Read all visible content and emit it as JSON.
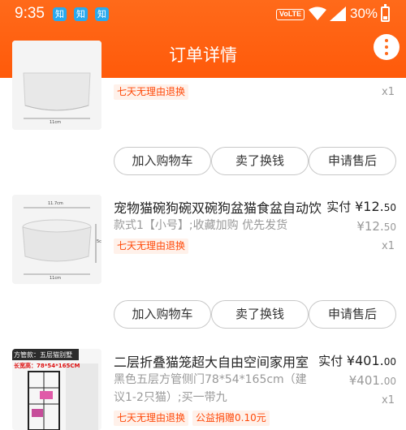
{
  "status_bar": {
    "time": "9:35",
    "notify_icons": [
      "知",
      "知",
      "知"
    ],
    "network": "VoLTE",
    "battery": "30%",
    "battery_level": 0.3
  },
  "header": {
    "title": "订单详情",
    "back_icon": "chevron-left-icon",
    "more_icon": "more-vertical-icon"
  },
  "items": [
    {
      "tag": "七天无理由退换",
      "qty": "x1",
      "thumb_label": "11cm",
      "actions": [
        "加入购物车",
        "卖了换钱",
        "申请售后"
      ]
    },
    {
      "title": "宠物猫碗狗碗双碗狗盆猫食盆自动饮",
      "spec": "款式1【小号】;收藏加购 优先发货",
      "tag": "七天无理由退换",
      "paid_label": "实付",
      "paid_int": "¥12.",
      "paid_dec": "50",
      "orig_int": "¥12.",
      "orig_dec": "50",
      "qty": "x1",
      "thumb_labels": [
        "11.7cm",
        "5cm",
        "11cm"
      ],
      "actions": [
        "加入购物车",
        "卖了换钱",
        "申请售后"
      ]
    },
    {
      "title": "二层折叠猫笼超大自由空间家用室",
      "spec_line1": "黑色五层方管侧门78*54*165cm（建",
      "spec_line2": "议1-2只猫）;买一带九",
      "tag": "七天无理由退换",
      "tag2": "公益捐赠0.10元",
      "paid_label": "实付",
      "paid_int": "¥401.",
      "paid_dec": "00",
      "orig_int": "¥401.",
      "orig_dec": "00",
      "qty": "x1",
      "thumb_banner": "方管款：五层猫别墅",
      "thumb_size": "长宽高：78*54*165CM"
    }
  ],
  "colors": {
    "brand": "#ff6a1a",
    "tag_text": "#ff4a0a",
    "tag_bg": "#fff1ea"
  }
}
